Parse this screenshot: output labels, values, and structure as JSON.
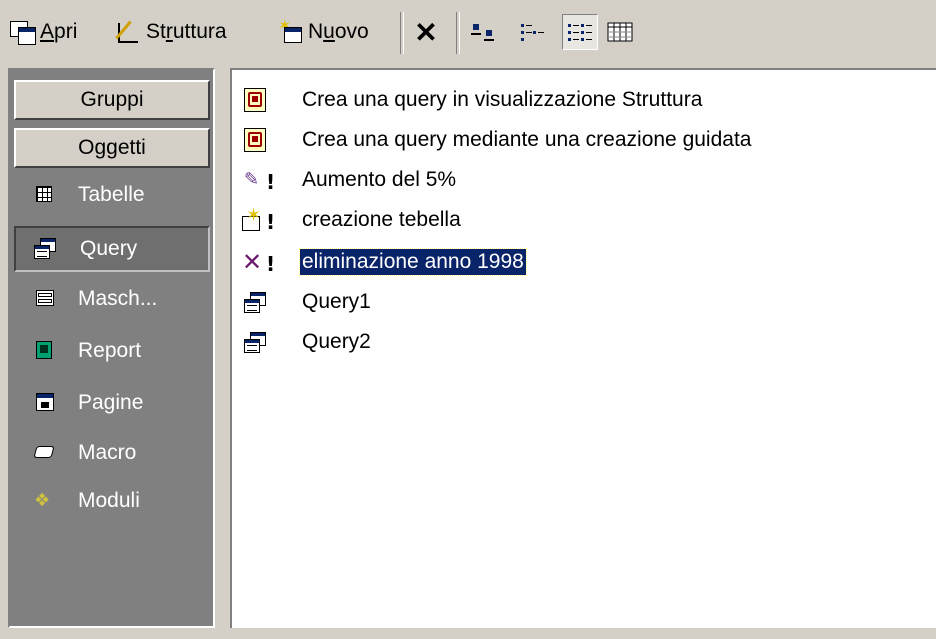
{
  "toolbar": {
    "open_label_accel": "A",
    "open_label_rest": "pri",
    "design_label_pre": "St",
    "design_label_accel": "r",
    "design_label_rest": "uttura",
    "new_label_pre": "N",
    "new_label_accel": "u",
    "new_label_rest": "ovo",
    "delete_glyph": "✕",
    "view_options": [
      "large-icons-icon",
      "small-icons-icon",
      "list-icon",
      "details-icon"
    ],
    "active_view": "list-icon"
  },
  "groups_panel": {
    "groups_label": "Gruppi",
    "objects_label": "Oggetti",
    "items": [
      {
        "label": "Tabelle",
        "icon": "table-icon",
        "selected": false
      },
      {
        "label": "Query",
        "icon": "query-icon",
        "selected": true
      },
      {
        "label": "Masch...",
        "icon": "form-icon",
        "selected": false
      },
      {
        "label": "Report",
        "icon": "report-icon",
        "selected": false
      },
      {
        "label": "Pagine",
        "icon": "page-icon",
        "selected": false
      },
      {
        "label": "Macro",
        "icon": "macro-icon",
        "selected": false
      },
      {
        "label": "Moduli",
        "icon": "module-icon",
        "selected": false
      }
    ]
  },
  "object_list": {
    "items": [
      {
        "label": "Crea una query in visualizzazione Struttura",
        "icon": "wizard-icon"
      },
      {
        "label": "Crea una query mediante una creazione guidata",
        "icon": "wizard-icon"
      },
      {
        "label": "Aumento del 5%",
        "icon": "update-query-icon"
      },
      {
        "label": "creazione tebella",
        "icon": "make-table-query-icon"
      },
      {
        "label": "eliminazione anno 1998",
        "icon": "delete-query-icon",
        "selected": true
      },
      {
        "label": "Query1",
        "icon": "select-query-icon"
      },
      {
        "label": "Query2",
        "icon": "select-query-icon"
      }
    ]
  },
  "colors": {
    "selection_bg": "#0a246a",
    "panel_bg": "#808080",
    "face": "#d4d0c8"
  }
}
